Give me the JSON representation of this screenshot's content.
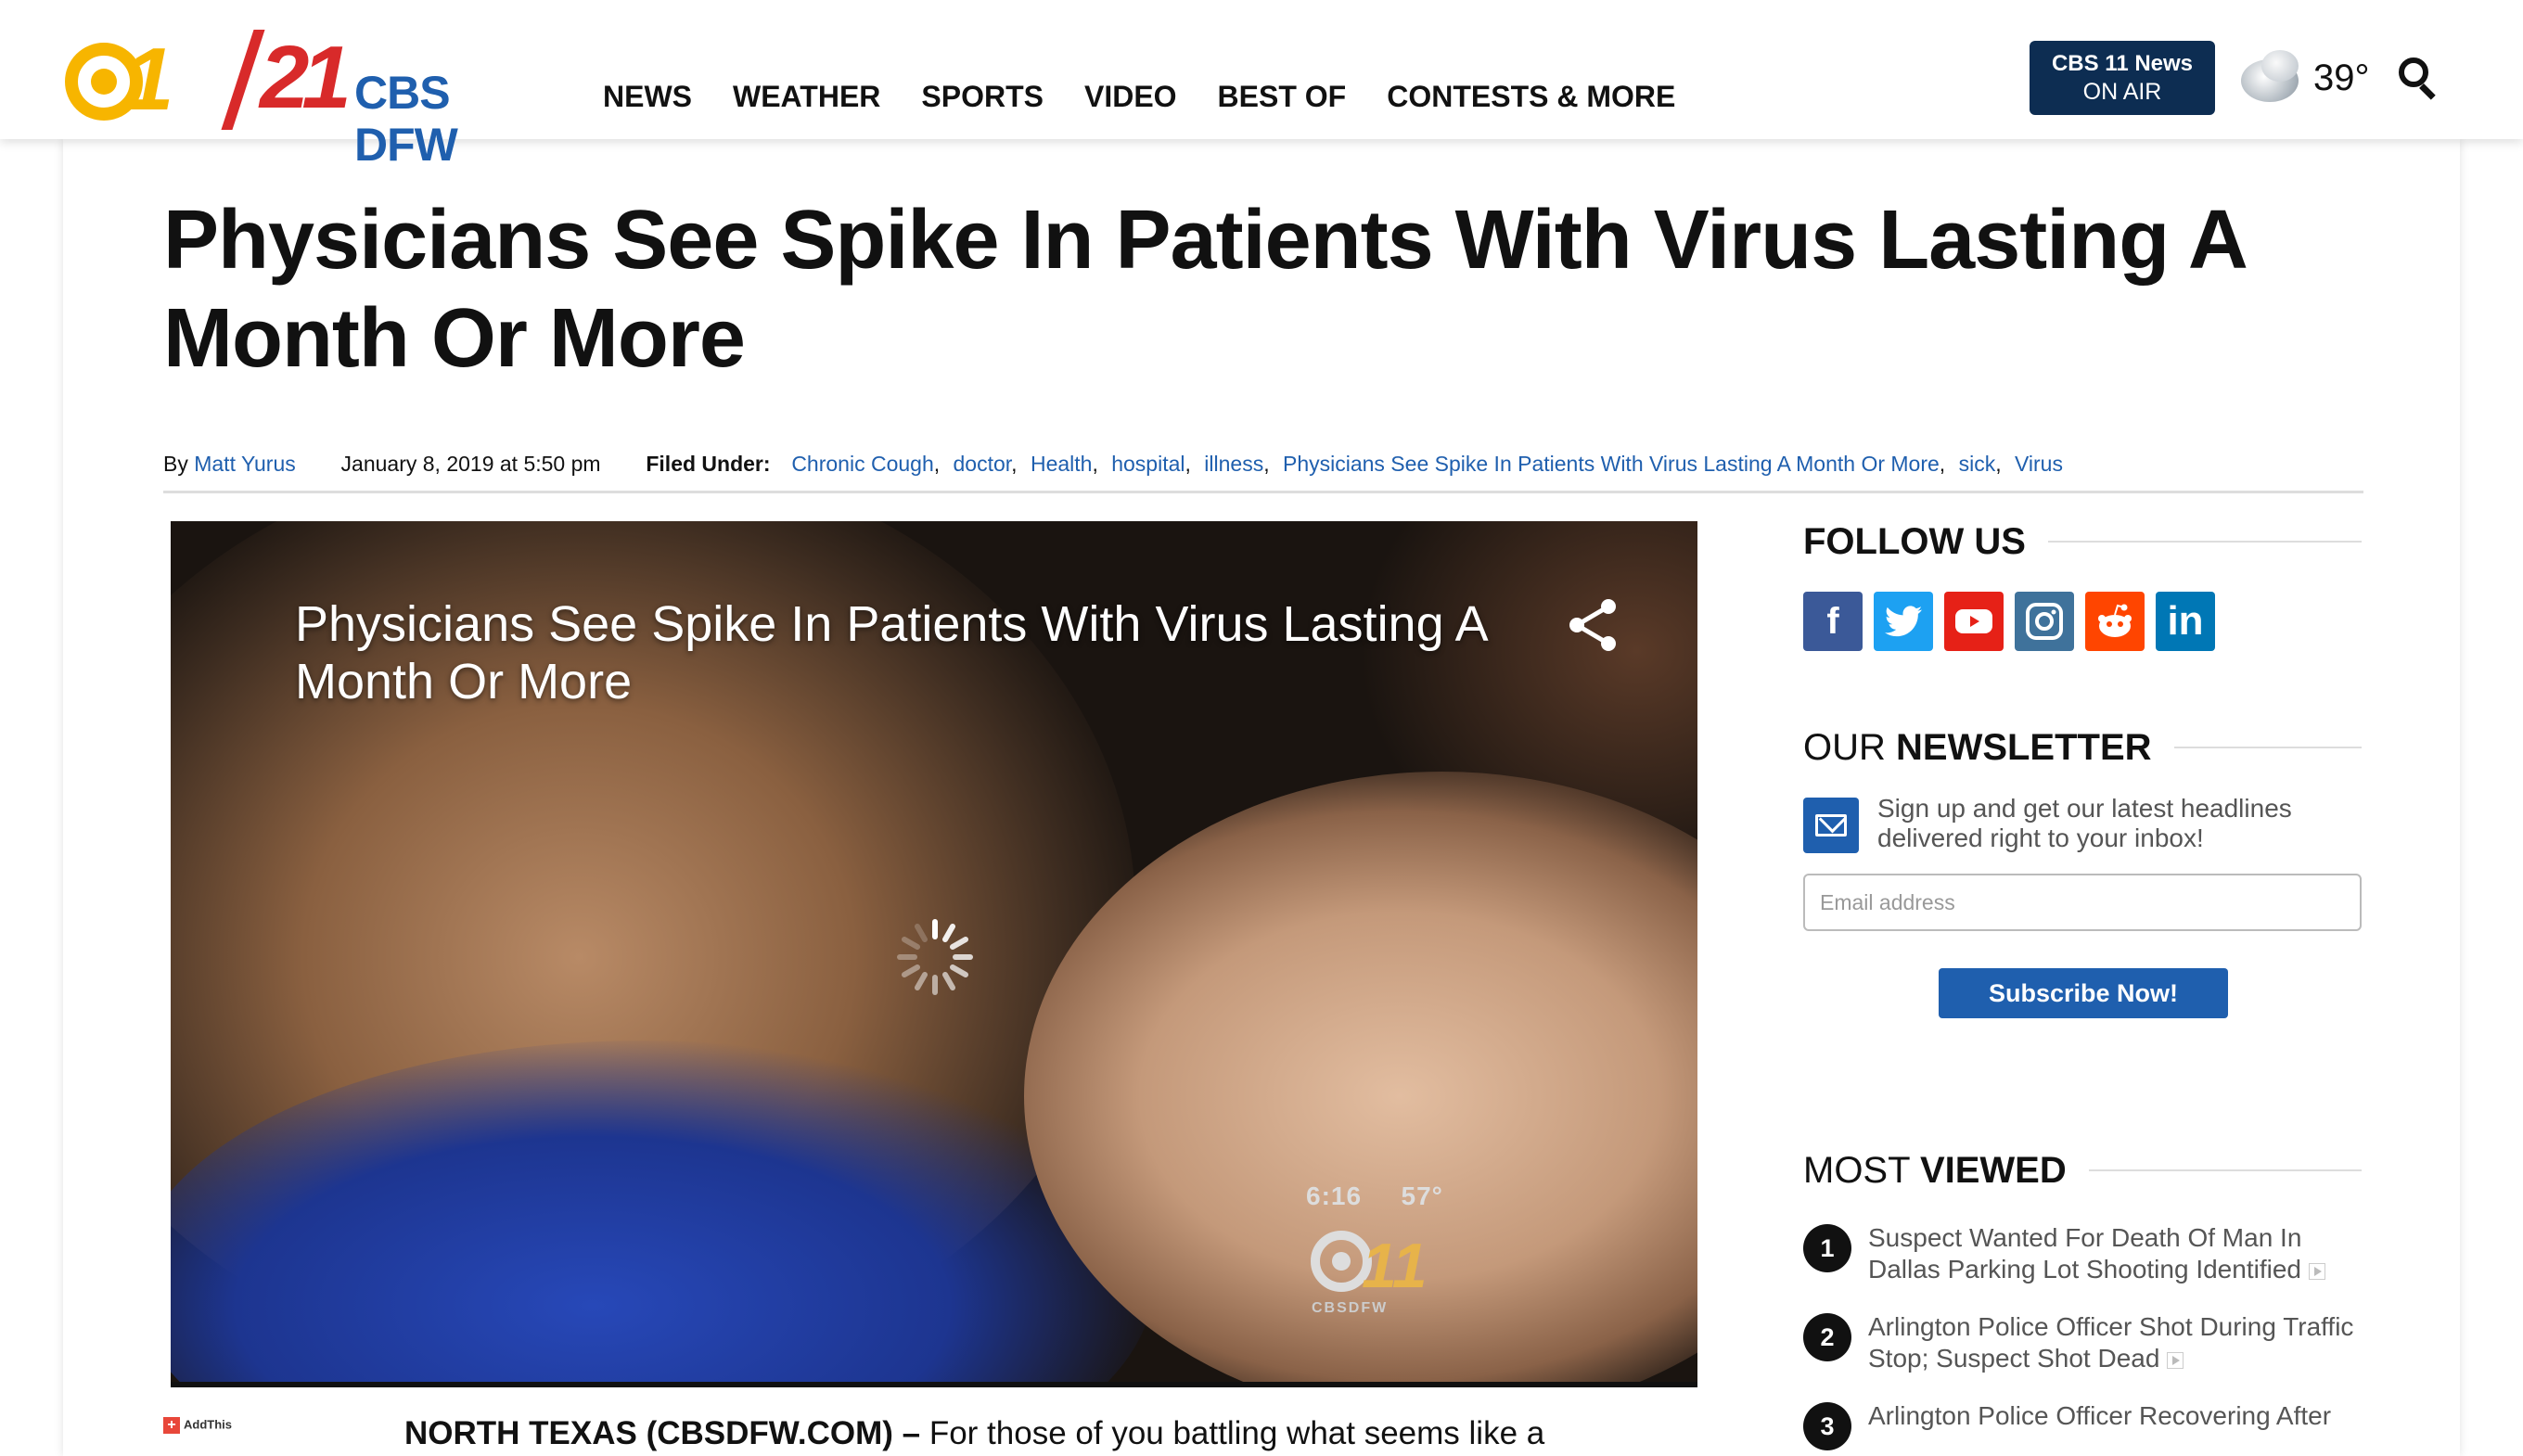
{
  "header": {
    "logo": {
      "one": "1",
      "twentyone": "21",
      "brand": "CBS DFW"
    },
    "nav": [
      "NEWS",
      "WEATHER",
      "SPORTS",
      "VIDEO",
      "BEST OF",
      "CONTESTS & MORE"
    ],
    "on_air": {
      "line1": "CBS 11 News",
      "line2": "ON AIR"
    },
    "weather": {
      "icon": "cloud-icon",
      "temp": "39°"
    },
    "search_icon": "search-icon"
  },
  "article": {
    "title": "Physicians See Spike In Patients With Virus Lasting A Month Or More",
    "byline_prefix": "By",
    "author": "Matt Yurus",
    "date": "January 8, 2019 at 5:50 pm",
    "filed_under_label": "Filed Under:",
    "tags": [
      "Chronic Cough",
      "doctor",
      "Health",
      "hospital",
      "illness",
      "Physicians See Spike In Patients With Virus Lasting A Month Or More",
      "sick",
      "Virus"
    ],
    "body_lead": "NORTH TEXAS (CBSDFW.COM) –",
    "body_text": " For those of you battling what seems like a",
    "addthis": "AddThis"
  },
  "video": {
    "title": "Physicians See Spike In Patients With Virus Lasting A Month Or More",
    "time": "6:16",
    "temp": "57°",
    "bug_text": "CBSDFW",
    "bug_mark": "11"
  },
  "sidebar": {
    "follow": {
      "title": "FOLLOW US",
      "networks": [
        {
          "name": "facebook",
          "glyph": "f",
          "color": "#3b5998"
        },
        {
          "name": "twitter",
          "glyph": "t",
          "color": "#1da1f2"
        },
        {
          "name": "youtube",
          "glyph": "▶",
          "color": "#e62117"
        },
        {
          "name": "instagram",
          "glyph": "◎",
          "color": "#3f729b"
        },
        {
          "name": "reddit",
          "glyph": "●",
          "color": "#ff4500"
        },
        {
          "name": "linkedin",
          "glyph": "in",
          "color": "#0077b5"
        }
      ]
    },
    "newsletter": {
      "title_light": "OUR ",
      "title_bold": "NEWSLETTER",
      "text": "Sign up and get our latest headlines delivered right to your inbox!",
      "placeholder": "Email address",
      "button": "Subscribe Now!"
    },
    "most_viewed": {
      "title_light": "MOST ",
      "title_bold": "VIEWED",
      "items": [
        {
          "n": "1",
          "text": "Suspect Wanted For Death Of Man In Dallas Parking Lot Shooting Identified"
        },
        {
          "n": "2",
          "text": "Arlington Police Officer Shot During Traffic Stop; Suspect Shot Dead"
        },
        {
          "n": "3",
          "text": "Arlington Police Officer Recovering After"
        }
      ]
    }
  }
}
